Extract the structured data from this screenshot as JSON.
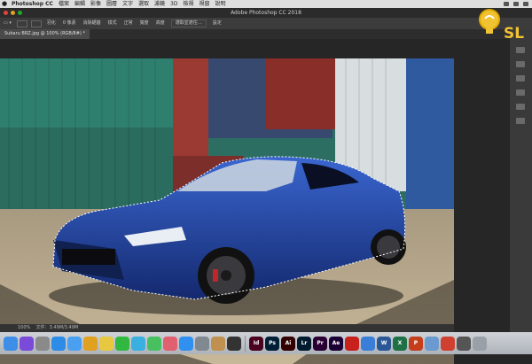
{
  "menubar": {
    "apple": "",
    "items": [
      "Photoshop CC",
      "檔案",
      "編輯",
      "影像",
      "圖層",
      "文字",
      "選取",
      "濾鏡",
      "3D",
      "檢視",
      "視窗",
      "說明"
    ]
  },
  "window": {
    "title": "Adobe Photoshop CC 2018"
  },
  "options": {
    "item1": "羽化",
    "item2": "0 像素",
    "item3": "消除鋸齒",
    "item4": "樣式",
    "item5": "正常",
    "item6": "寬度",
    "item7": "高度",
    "select_mask": "選取並遮住…",
    "extra": "設定"
  },
  "document": {
    "tab_label": "Subaru BRZ.jpg @ 100% (RGB/8#) *"
  },
  "status": {
    "zoom": "100%",
    "doc_info": "文件：3.49M/3.49M"
  },
  "logo": {
    "text": "SL"
  },
  "dock": {
    "apps": [
      {
        "name": "finder-icon",
        "label": "",
        "color": "#3d8ee6"
      },
      {
        "name": "siri-icon",
        "label": "",
        "color": "#7a4ad8"
      },
      {
        "name": "launchpad-icon",
        "label": "",
        "color": "#8a8a8a"
      },
      {
        "name": "safari-icon",
        "label": "",
        "color": "#2c8ce8"
      },
      {
        "name": "mail-icon",
        "label": "",
        "color": "#4aa0f0"
      },
      {
        "name": "chrome-icon",
        "label": "",
        "color": "#e0a020"
      },
      {
        "name": "notes-icon",
        "label": "",
        "color": "#e8c840"
      },
      {
        "name": "line-icon",
        "label": "",
        "color": "#30b840"
      },
      {
        "name": "messages-icon",
        "label": "",
        "color": "#3ab0e0"
      },
      {
        "name": "facetime-icon",
        "label": "",
        "color": "#48c060"
      },
      {
        "name": "photos-icon",
        "label": "",
        "color": "#e06070"
      },
      {
        "name": "appstore-icon",
        "label": "",
        "color": "#3090f0"
      },
      {
        "name": "preferences-icon",
        "label": "",
        "color": "#808890"
      },
      {
        "name": "folder-icon",
        "label": "",
        "color": "#c09050"
      },
      {
        "name": "terminal-icon",
        "label": "",
        "color": "#333333"
      },
      {
        "name": "indesign-icon",
        "label": "Id",
        "color": "#49021f"
      },
      {
        "name": "photoshop-icon",
        "label": "Ps",
        "color": "#001e36"
      },
      {
        "name": "illustrator-icon",
        "label": "Ai",
        "color": "#330000"
      },
      {
        "name": "lightroom-icon",
        "label": "Lr",
        "color": "#001a2e"
      },
      {
        "name": "premiere-icon",
        "label": "Pr",
        "color": "#2a0034"
      },
      {
        "name": "aftereffects-icon",
        "label": "Ae",
        "color": "#1a0033"
      },
      {
        "name": "acrobat-icon",
        "label": "",
        "color": "#c8201a"
      },
      {
        "name": "keynote-icon",
        "label": "",
        "color": "#3a7ed8"
      },
      {
        "name": "word-icon",
        "label": "W",
        "color": "#2b5797"
      },
      {
        "name": "excel-icon",
        "label": "X",
        "color": "#1e7145"
      },
      {
        "name": "powerpoint-icon",
        "label": "P",
        "color": "#c43e1c"
      },
      {
        "name": "preview-icon",
        "label": "",
        "color": "#6a9ad0"
      },
      {
        "name": "chrome2-icon",
        "label": "",
        "color": "#d04030"
      },
      {
        "name": "calculator-icon",
        "label": "",
        "color": "#555555"
      },
      {
        "name": "trash-icon",
        "label": "",
        "color": "#9aa0a8"
      }
    ]
  },
  "colors": {
    "car_blue": "#1f3f9a",
    "container_green": "#2e7a6a",
    "container_red": "#9a3a32",
    "ground": "#b8a888"
  }
}
